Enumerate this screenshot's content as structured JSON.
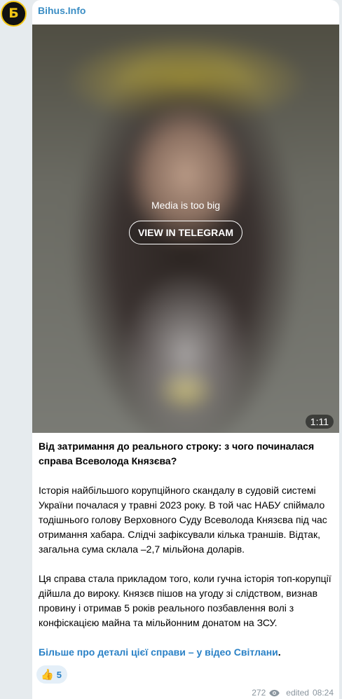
{
  "channel": {
    "name": "Bihus.Info",
    "avatar_glyph": "Б",
    "accent": "#f3c614"
  },
  "media": {
    "notice": "Media is too big",
    "button_label": "VIEW IN TELEGRAM",
    "duration": "1:11"
  },
  "post": {
    "title": "Від затримання до реального строку: з чого починалася справа Всеволода Князєва?",
    "paragraph1": "Історія найбільшого корупційного скандалу в судовій системі України почалася у травні 2023 року. В той час НАБУ спіймало тодішнього голову Верховного Суду Всеволода Князєва під час отримання хабара. Слідчі зафіксували кілька траншів. Відтак, загальна сума склала –2,7 мільйона доларів.",
    "paragraph2": "Ця справа стала прикладом того, коли гучна історія топ-корупції дійшла до вироку. Князєв пішов на угоду зі слідством, визнав провину і отримав 5 років реального позбавлення волі з конфіскацією майна та мільйонним донатом на ЗСУ.",
    "link_text": "Більше про деталі цієї справи – у відео Світлани",
    "link_suffix": "."
  },
  "reactions": [
    {
      "emoji": "👍",
      "icon": "thumbs-up-icon",
      "count": "5"
    }
  ],
  "footer": {
    "views": "272",
    "views_icon": "eye-icon",
    "edited_label": "edited",
    "time": "08:24"
  }
}
